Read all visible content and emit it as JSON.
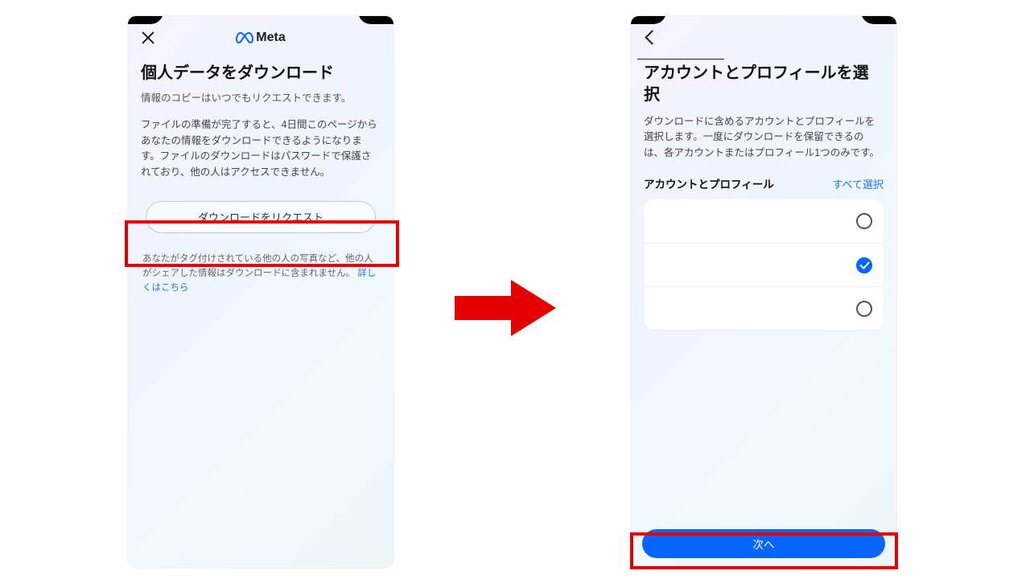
{
  "brand": {
    "name": "Meta"
  },
  "screen1": {
    "title": "個人データをダウンロード",
    "subtitle": "情報のコピーはいつでもリクエストできます。",
    "paragraph": "ファイルの準備が完了すると、4日間このページからあなたの情報をダウンロードできるようになります。ファイルのダウンロードはパスワードで保護されており、他の人はアクセスできません。",
    "request_button": "ダウンロードをリクエスト",
    "footnote_text": "あなたがタグ付けされている他の人の写真など、他の人がシェアした情報はダウンロードに含まれません。",
    "footnote_link": "詳しくはこちら"
  },
  "screen2": {
    "title": "アカウントとプロフィールを選択",
    "paragraph": "ダウンロードに含めるアカウントとプロフィールを選択します。一度にダウンロードを保留できるのは、各アカウントまたはプロフィール1つのみです。",
    "section_label": "アカウントとプロフィール",
    "select_all": "すべて選択",
    "rows": [
      {
        "selected": false
      },
      {
        "selected": true
      },
      {
        "selected": false
      }
    ],
    "next_button": "次へ"
  },
  "colors": {
    "highlight": "#e40000",
    "primary": "#0866ff",
    "link": "#1877f2"
  }
}
